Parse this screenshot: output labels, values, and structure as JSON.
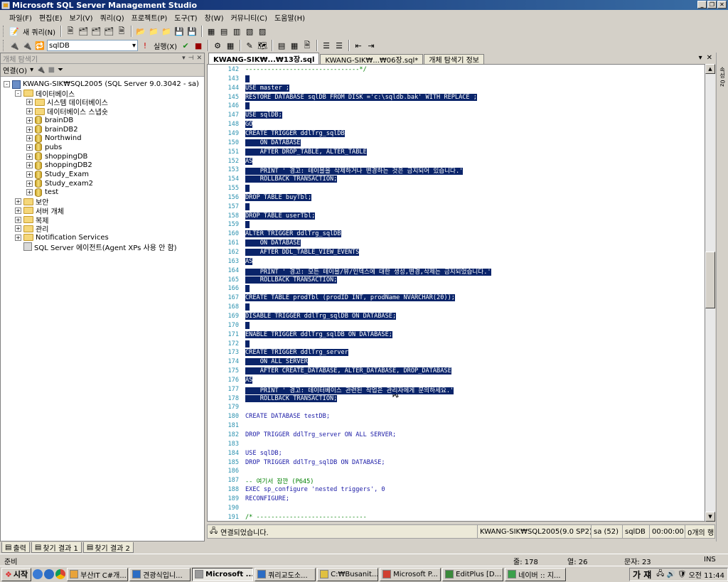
{
  "window": {
    "title": "Microsoft SQL Server Management Studio"
  },
  "menu": [
    "파일(F)",
    "편집(E)",
    "보기(V)",
    "쿼리(Q)",
    "프로젝트(P)",
    "도구(T)",
    "창(W)",
    "커뮤니티(C)",
    "도움말(H)"
  ],
  "toolbar1": {
    "new_query": "새 쿼리(N)"
  },
  "toolbar2": {
    "database": "sqlDB",
    "execute": "실행(X)"
  },
  "explorer": {
    "title": "개체 탐색기",
    "connect": "연결(O)",
    "tree": [
      {
        "label": "KWANG-SIK₩SQL2005 (SQL Server 9.0.3042 - sa)",
        "icon": "server-icon",
        "exp": "-"
      },
      {
        "label": "데이터베이스",
        "icon": "folder-icon",
        "exp": "-"
      },
      {
        "label": "시스템 데이터베이스",
        "icon": "folder-icon",
        "exp": "+"
      },
      {
        "label": "데이터베이스 스냅숏",
        "icon": "folder-icon",
        "exp": "+"
      },
      {
        "label": "brainDB",
        "icon": "database-icon",
        "exp": "+"
      },
      {
        "label": "brainDB2",
        "icon": "database-icon",
        "exp": "+"
      },
      {
        "label": "Northwind",
        "icon": "database-icon",
        "exp": "+"
      },
      {
        "label": "pubs",
        "icon": "database-icon",
        "exp": "+"
      },
      {
        "label": "shoppingDB",
        "icon": "database-icon",
        "exp": "+"
      },
      {
        "label": "shoppingDB2",
        "icon": "database-icon",
        "exp": "+"
      },
      {
        "label": "Study_Exam",
        "icon": "database-icon",
        "exp": "+"
      },
      {
        "label": "Study_exam2",
        "icon": "database-icon",
        "exp": "+"
      },
      {
        "label": "test",
        "icon": "database-icon",
        "exp": "+"
      },
      {
        "label": "보안",
        "icon": "folder-icon",
        "exp": "+"
      },
      {
        "label": "서버 개체",
        "icon": "folder-icon",
        "exp": "+"
      },
      {
        "label": "복제",
        "icon": "folder-icon",
        "exp": "+"
      },
      {
        "label": "관리",
        "icon": "folder-icon",
        "exp": "+"
      },
      {
        "label": "Notification Services",
        "icon": "folder-icon",
        "exp": "+"
      },
      {
        "label": "SQL Server 에이전트(Agent XPs 사용 안 함)",
        "icon": "agent-icon",
        "exp": ""
      }
    ]
  },
  "tabs": [
    {
      "label": "KWANG-SIK₩...₩13장.sql"
    },
    {
      "label": "KWANG-SIK₩...₩06장.sql*"
    },
    {
      "label": "개체 탐색기 정보"
    }
  ],
  "code_lines": [
    {
      "n": "142",
      "t": "-------------------------------*/",
      "sel": false,
      "c": "green"
    },
    {
      "n": "143",
      "t": "",
      "sel": true
    },
    {
      "n": "144",
      "t": "USE master ;",
      "sel": true
    },
    {
      "n": "145",
      "t": "RESTORE DATABASE sqlDB FROM DISK ='c:\\sqldb.bak' WITH REPLACE ;",
      "sel": true
    },
    {
      "n": "146",
      "t": "",
      "sel": true
    },
    {
      "n": "147",
      "t": "USE sqlDB;",
      "sel": true
    },
    {
      "n": "148",
      "t": "GO",
      "sel": true
    },
    {
      "n": "149",
      "t": "CREATE TRIGGER ddlTrg_sqlDB",
      "sel": true
    },
    {
      "n": "150",
      "t": "    ON DATABASE",
      "sel": true
    },
    {
      "n": "151",
      "t": "    AFTER DROP_TABLE, ALTER_TABLE",
      "sel": true
    },
    {
      "n": "152",
      "t": "AS",
      "sel": true
    },
    {
      "n": "153",
      "t": "    PRINT ' 경고: 테이블을 삭제하거나 변경하는 것은 금지되어 있습니다.'",
      "sel": true
    },
    {
      "n": "154",
      "t": "    ROLLBACK TRANSACTION;",
      "sel": true
    },
    {
      "n": "155",
      "t": "",
      "sel": true
    },
    {
      "n": "156",
      "t": "DROP TABLE buyTbl;",
      "sel": true
    },
    {
      "n": "157",
      "t": "",
      "sel": true
    },
    {
      "n": "158",
      "t": "DROP TABLE userTbl;",
      "sel": true
    },
    {
      "n": "159",
      "t": "",
      "sel": true
    },
    {
      "n": "160",
      "t": "ALTER TRIGGER ddlTrg_sqlDB",
      "sel": true
    },
    {
      "n": "161",
      "t": "    ON DATABASE",
      "sel": true
    },
    {
      "n": "162",
      "t": "    AFTER DDL_TABLE_VIEW_EVENTS",
      "sel": true
    },
    {
      "n": "163",
      "t": "AS",
      "sel": true
    },
    {
      "n": "164",
      "t": "    PRINT ' 경고: 모든 테이블/뷰/인덱스에 대한 생성,변경,삭제는 금지되었습니다.'",
      "sel": true
    },
    {
      "n": "165",
      "t": "    ROLLBACK TRANSACTION;",
      "sel": true
    },
    {
      "n": "166",
      "t": "",
      "sel": true
    },
    {
      "n": "167",
      "t": "CREATE TABLE prodTbl (prodID INT, prodName NVARCHAR(20));",
      "sel": true
    },
    {
      "n": "168",
      "t": "",
      "sel": true
    },
    {
      "n": "169",
      "t": "DISABLE TRIGGER ddlTrg_sqlDB ON DATABASE;",
      "sel": true
    },
    {
      "n": "170",
      "t": "",
      "sel": true
    },
    {
      "n": "171",
      "t": "ENABLE TRIGGER ddlTrg_sqlDB ON DATABASE;",
      "sel": true
    },
    {
      "n": "172",
      "t": "",
      "sel": true
    },
    {
      "n": "173",
      "t": "CREATE TRIGGER ddlTrg_server",
      "sel": true
    },
    {
      "n": "174",
      "t": "    ON ALL SERVER",
      "sel": true
    },
    {
      "n": "175",
      "t": "    AFTER CREATE_DATABASE, ALTER_DATABASE, DROP_DATABASE",
      "sel": true
    },
    {
      "n": "176",
      "t": "AS",
      "sel": true
    },
    {
      "n": "177",
      "t": "    PRINT ' 경고: 데이터베이스 관련된 작업은 관리자에게 문의하세요.'",
      "sel": true
    },
    {
      "n": "178",
      "t": "    ROLLBACK TRANSACTION;",
      "sel": true
    },
    {
      "n": "179",
      "t": "",
      "sel": false
    },
    {
      "n": "180",
      "t": "CREATE DATABASE testDB;",
      "sel": false,
      "c": "blue"
    },
    {
      "n": "181",
      "t": "",
      "sel": false
    },
    {
      "n": "182",
      "t": "DROP TRIGGER ddlTrg_server ON ALL SERVER;",
      "sel": false,
      "c": "blue"
    },
    {
      "n": "183",
      "t": "",
      "sel": false
    },
    {
      "n": "184",
      "t": "USE sqlDB;",
      "sel": false,
      "c": "blue"
    },
    {
      "n": "185",
      "t": "DROP TRIGGER ddlTrg_sqlDB ON DATABASE;",
      "sel": false,
      "c": "blue"
    },
    {
      "n": "186",
      "t": "",
      "sel": false
    },
    {
      "n": "187",
      "t": "-- 여기서 잠깐 (P645)",
      "sel": false,
      "c": "green"
    },
    {
      "n": "188",
      "t": "EXEC sp_configure 'nested triggers', 0",
      "sel": false,
      "c": "blue"
    },
    {
      "n": "189",
      "t": "RECONFIGURE;",
      "sel": false,
      "c": "blue"
    },
    {
      "n": "190",
      "t": "",
      "sel": false
    },
    {
      "n": "191",
      "t": "/* ------------------------------",
      "sel": false,
      "c": "green"
    }
  ],
  "query_status": {
    "message": "연결되었습니다.",
    "server": "KWANG-SIK₩SQL2005(9.0 SP2)",
    "user": "sa (52)",
    "db": "sqlDB",
    "time": "00:00:00",
    "rows": "0개의 행"
  },
  "side_strip": "속성 0z",
  "output_tabs": [
    "출력",
    "찾기 결과 1",
    "찾기 결과 2"
  ],
  "statusbar": {
    "ready": "준비",
    "line": "줄: 178",
    "col": "열: 26",
    "char": "문자: 23",
    "mode": "INS"
  },
  "taskbar": {
    "start": "시작",
    "tasks": [
      {
        "label": "부산IT C#개...",
        "active": false
      },
      {
        "label": "견광식입니...",
        "active": false
      },
      {
        "label": "Microsoft ...",
        "active": true
      },
      {
        "label": "쿼리교도소...",
        "active": false
      },
      {
        "label": "C:₩Busanit...",
        "active": false
      },
      {
        "label": "Microsoft P...",
        "active": false
      },
      {
        "label": "EditPlus [D...",
        "active": false
      },
      {
        "label": "네이버 :: 지...",
        "active": false
      }
    ],
    "ime": "가 쟤",
    "clock": "오전 11:44"
  }
}
